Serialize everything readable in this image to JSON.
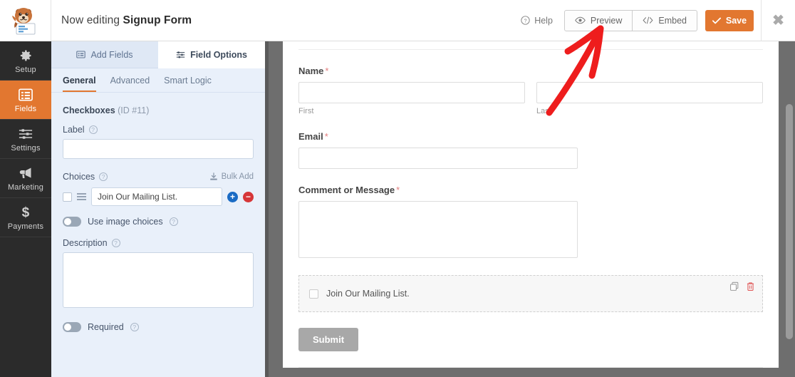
{
  "topbar": {
    "logo_icon": "wpforms-beaver-logo",
    "title_prefix": "Now editing",
    "form_name": "Signup Form",
    "help_label": "Help",
    "help_icon": "question-circle-icon",
    "preview_label": "Preview",
    "preview_icon": "eye-icon",
    "embed_label": "Embed",
    "embed_icon": "code-brackets-icon",
    "save_label": "Save",
    "save_icon": "check-icon",
    "close_icon": "close-x-icon",
    "save_color": "#e27730"
  },
  "sidebar": {
    "items": [
      {
        "label": "Setup",
        "icon": "gear-icon",
        "active": false
      },
      {
        "label": "Fields",
        "icon": "list-fields-icon",
        "active": true
      },
      {
        "label": "Settings",
        "icon": "sliders-icon",
        "active": false
      },
      {
        "label": "Marketing",
        "icon": "megaphone-icon",
        "active": false
      },
      {
        "label": "Payments",
        "icon": "dollar-sign-icon",
        "active": false
      }
    ],
    "active_color": "#e27730",
    "background": "#2b2b2b"
  },
  "panel": {
    "tabs": [
      {
        "label": "Add Fields",
        "icon": "add-fields-icon",
        "active": false
      },
      {
        "label": "Field Options",
        "icon": "field-options-icon",
        "active": true
      }
    ],
    "subtabs": [
      {
        "label": "General",
        "active": true
      },
      {
        "label": "Advanced",
        "active": false
      },
      {
        "label": "Smart Logic",
        "active": false
      }
    ],
    "field_type": "Checkboxes",
    "field_id": "(ID #11)",
    "label_heading": "Label",
    "label_value": "",
    "choices_heading": "Choices",
    "bulk_add_label": "Bulk Add",
    "bulk_add_icon": "bulk-add-import-icon",
    "choices": [
      {
        "value": "Join Our Mailing List.",
        "checked": false,
        "drag_icon": "drag-handle-icon",
        "add_icon": "plus-circle-icon",
        "delete_icon": "minus-circle-icon"
      }
    ],
    "image_choices_label": "Use image choices",
    "image_choices_on": false,
    "description_heading": "Description",
    "description_value": "",
    "required_label": "Required",
    "required_on": false,
    "help_icon": "question-circle-icon",
    "background": "#e9f0fa"
  },
  "form_preview": {
    "fields": [
      {
        "name": "name-field",
        "label": "Name",
        "required": true,
        "type": "name",
        "sublabels": [
          "First",
          "Last"
        ],
        "values": [
          "",
          ""
        ]
      },
      {
        "name": "email-field",
        "label": "Email",
        "required": true,
        "type": "text",
        "value": ""
      },
      {
        "name": "comment-field",
        "label": "Comment or Message",
        "required": true,
        "type": "textarea",
        "value": ""
      }
    ],
    "selected_field": {
      "name": "checkboxes-field",
      "choice_label": "Join Our Mailing List.",
      "checked": false,
      "duplicate_icon": "duplicate-icon",
      "delete_icon": "trash-icon"
    },
    "submit_label": "Submit",
    "submit_color": "#a8a8a8"
  },
  "annotation": {
    "arrow_icon": "red-arrow-pointing-to-preview",
    "color": "#ee1d1d"
  },
  "scrollbar": {
    "name": "vertical-scrollbar",
    "track_color": "#6e6e6e",
    "thumb_color": "#9b9b9b"
  }
}
